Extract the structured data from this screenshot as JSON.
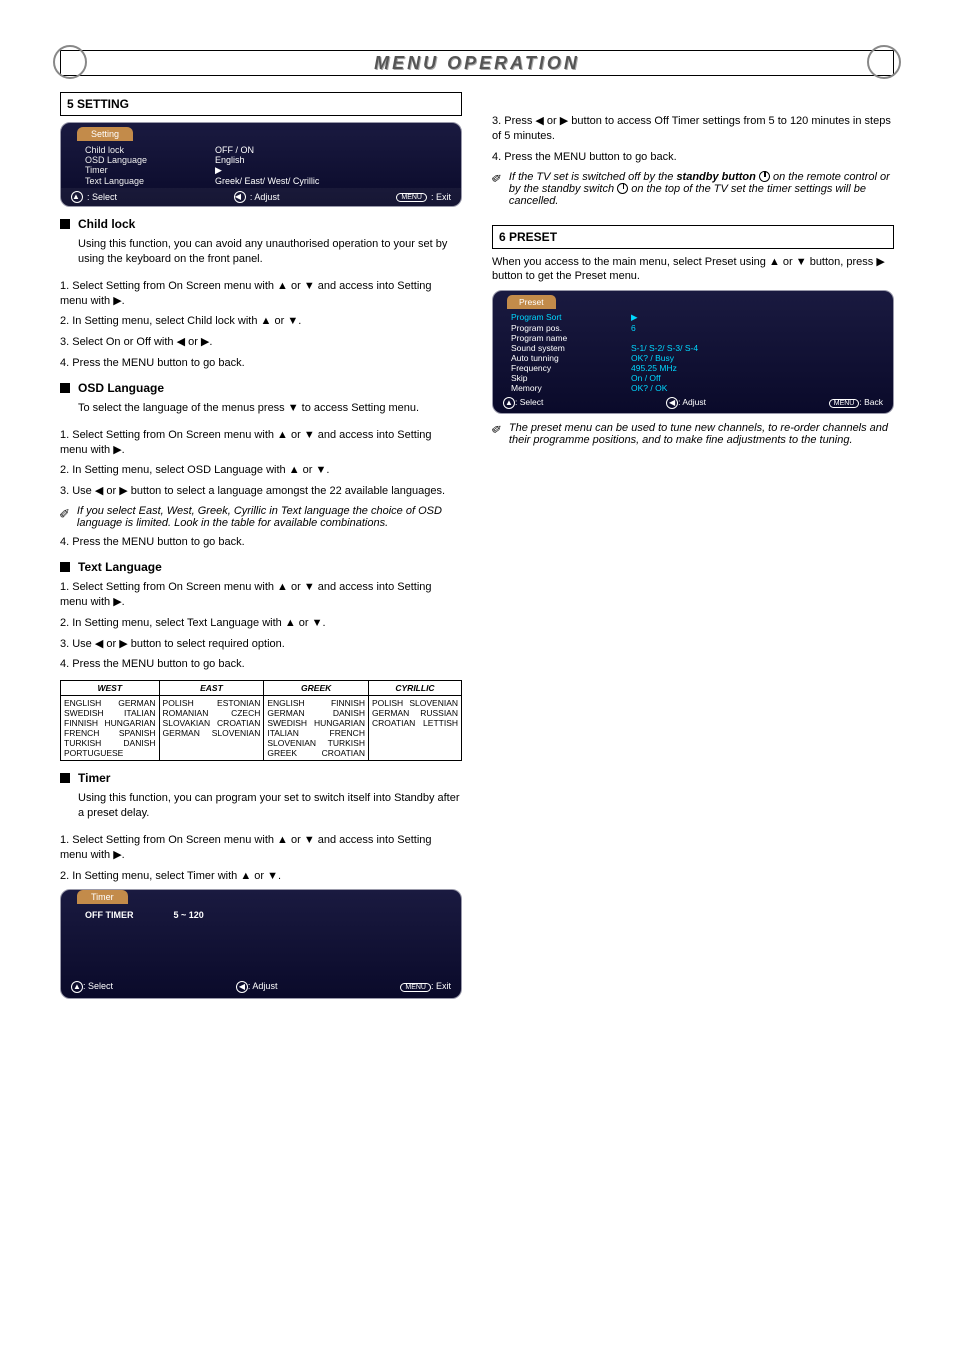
{
  "page_title": "MENU OPERATION",
  "left": {
    "section1_header": "5 SETTING",
    "osd_setting": {
      "tab": "Setting",
      "rows": [
        {
          "label": "Child lock",
          "value": "OFF / ON"
        },
        {
          "label": "OSD Language",
          "value": "English"
        },
        {
          "label": "Timer",
          "value": "▶"
        },
        {
          "label": "Text Language",
          "value": "Greek/ East/ West/ Cyrillic"
        }
      ],
      "footer": {
        "select": ": Select",
        "adjust": ": Adjust",
        "exit": ": Exit"
      }
    },
    "child_lock": {
      "title": "Child lock",
      "p1_a": "Using this function, you can avoid any unauthorised operation to your set by using the keyboard on the front panel.",
      "p2": "1. Select Setting from On Screen menu with ▲ or ▼ and access into Setting menu with ▶.",
      "p3": "2. In Setting menu, select Child lock with ▲ or ▼.",
      "p4": "3. Select On or Off with ◀ or ▶.",
      "p5": "4. Press the MENU button to go back."
    },
    "osd_lang": {
      "title": "OSD Language",
      "p1": "To select the language of the menus press ▼ to access Setting menu.",
      "p2": "1. Select Setting from On Screen menu with ▲ or ▼ and access into Setting menu with ▶.",
      "p3": "2. In Setting menu, select OSD Language with ▲ or ▼.",
      "p4": "3. Use ◀ or ▶ button to select a language amongst the 22 available languages.",
      "note_a": "If you select East, West, Greek, Cyrillic in Text language the choice of OSD language is limited. Look in the table for available combinations.",
      "p5": "4. Press the MENU button to go back."
    },
    "text_lang": {
      "title": "Text Language",
      "p1": "1. Select Setting from On Screen menu with ▲ or ▼ and access into Setting menu with ▶.",
      "p2": "2. In Setting menu, select Text Language with ▲ or ▼.",
      "p3": "3. Use ◀ or ▶ button to select required option.",
      "p4": "4. Press the MENU button to go back.",
      "table": {
        "headers": [
          "WEST",
          "EAST",
          "GREEK",
          "CYRILLIC"
        ],
        "cols": {
          "WEST": [
            [
              "ENGLISH",
              "GERMAN"
            ],
            [
              "SWEDISH",
              "ITALIAN"
            ],
            [
              "FINNISH",
              "HUNGARIAN"
            ],
            [
              "FRENCH",
              "SPANISH"
            ],
            [
              "TURKISH",
              "DANISH"
            ],
            [
              "PORTUGUESE",
              ""
            ]
          ],
          "EAST": [
            [
              "POLISH",
              "ESTONIAN"
            ],
            [
              "ROMANIAN",
              "CZECH"
            ],
            [
              "SLOVAKIAN",
              "CROATIAN"
            ],
            [
              "GERMAN",
              "SLOVENIAN"
            ]
          ],
          "GREEK": [
            [
              "ENGLISH",
              "FINNISH"
            ],
            [
              "GERMAN",
              "DANISH"
            ],
            [
              "SWEDISH",
              "HUNGARIAN"
            ],
            [
              "ITALIAN",
              "FRENCH"
            ],
            [
              "SLOVENIAN",
              "TURKISH"
            ],
            [
              "GREEK",
              "CROATIAN"
            ]
          ],
          "CYRILLIC": [
            [
              "POLISH",
              "SLOVENIAN"
            ],
            [
              "GERMAN",
              "RUSSIAN"
            ],
            [
              "CROATIAN",
              "LETTISH"
            ]
          ]
        }
      }
    },
    "timer": {
      "title": "Timer",
      "p1": "Using this function, you can program your set to switch itself into Standby after a preset delay.",
      "p2": "1. Select Setting from On Screen menu with ▲ or ▼ and access into Setting menu with ▶.",
      "p3": "2. In Setting menu, select Timer with ▲ or ▼.",
      "osd": {
        "tab": "Timer",
        "row_label": "OFF TIMER",
        "row_value": "5 ~ 120",
        "footer": {
          "select": ": Select",
          "adjust": ": Adjust",
          "exit": ": Exit"
        }
      }
    }
  },
  "right": {
    "timer_cont": {
      "p1": "3. Press ◀ or ▶ button to access Off Timer settings from 5 to 120 minutes in steps of 5 minutes.",
      "p2": "4. Press the MENU button to go back.",
      "note_a": "If the TV set is switched off by the ",
      "note_b": "standby button",
      "note_c": " on the remote control or by the standby switch ",
      "note_d": " on the top of the TV set the timer settings will be cancelled."
    },
    "preset": {
      "header": "6 PRESET",
      "p1": "When you access to the main menu, select Preset using ▲ or ▼ button, press ▶ button to get the Preset menu.",
      "osd": {
        "tab": "Preset",
        "rows": [
          {
            "label": "Program Sort",
            "value": "▶"
          },
          {
            "label": "Program pos.",
            "value": "6"
          },
          {
            "label": "Program name",
            "value": ""
          },
          {
            "label": "Sound system",
            "value": "S-1/ S-2/ S-3/ S-4"
          },
          {
            "label": "Auto tunning",
            "value": "OK? / Busy"
          },
          {
            "label": "Frequency",
            "value": "495.25 MHz"
          },
          {
            "label": "Skip",
            "value": "On / Off"
          },
          {
            "label": "Memory",
            "value": "OK? / OK"
          }
        ],
        "footer": {
          "select": ": Select",
          "adjust": ": Adjust",
          "back": ": Back"
        }
      },
      "note": "The preset menu can be used to tune new channels, to re-order channels and their programme positions, and to make fine adjustments to the tuning."
    }
  }
}
